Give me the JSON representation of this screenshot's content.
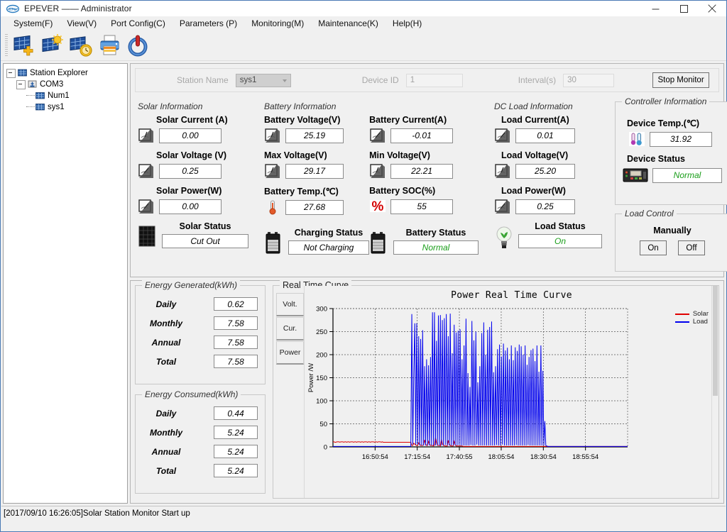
{
  "window": {
    "title": "EPEVER —— Administrator",
    "logo_icon": "epever-logo-icon",
    "minimize_icon": "minimize-icon",
    "maximize_icon": "maximize-icon",
    "close_icon": "close-icon"
  },
  "menubar": [
    {
      "label": "System(F)",
      "name": "menu-system"
    },
    {
      "label": "View(V)",
      "name": "menu-view"
    },
    {
      "label": "Port Config(C)",
      "name": "menu-port-config"
    },
    {
      "label": "Parameters (P)",
      "name": "menu-parameters"
    },
    {
      "label": "Monitoring(M)",
      "name": "menu-monitoring"
    },
    {
      "label": "Maintenance(K)",
      "name": "menu-maintenance"
    },
    {
      "label": "Help(H)",
      "name": "menu-help"
    }
  ],
  "toolbar": [
    {
      "icon": "add-station-icon"
    },
    {
      "icon": "solar-sun-icon"
    },
    {
      "icon": "solar-clock-icon"
    },
    {
      "icon": "print-icon"
    },
    {
      "icon": "power-icon"
    }
  ],
  "tree": {
    "root": {
      "label": "Station Explorer",
      "icon": "station-icon"
    },
    "com": {
      "label": "COM3",
      "icon": "port-icon"
    },
    "children": [
      {
        "label": "Num1",
        "icon": "device-icon"
      },
      {
        "label": "sys1",
        "icon": "device-icon"
      }
    ]
  },
  "header": {
    "station_name_label": "Station Name",
    "station_name_value": "sys1",
    "device_id_label": "Device ID",
    "device_id_value": "1",
    "interval_label": "Interval(s)",
    "interval_value": "30",
    "stop_monitor_label": "Stop Monitor"
  },
  "solar": {
    "legend": "Solar Information",
    "fields": [
      {
        "label": "Solar Current (A)",
        "value": "0.00",
        "icon": "ammeter-icon"
      },
      {
        "label": "Solar Voltage (V)",
        "value": "0.25",
        "icon": "voltmeter-icon"
      },
      {
        "label": "Solar Power(W)",
        "value": "0.00",
        "icon": "wattmeter-icon"
      }
    ],
    "status_label": "Solar Status",
    "status_value": "Cut Out",
    "status_icon": "solar-panel-icon"
  },
  "battery": {
    "legend": "Battery Information",
    "fields_left": [
      {
        "label": "Battery Voltage(V)",
        "value": "25.19",
        "icon": "voltmeter-icon"
      },
      {
        "label": "Max Voltage(V)",
        "value": "29.17",
        "icon": "voltmeter-icon"
      },
      {
        "label": "Battery Temp.(℃)",
        "value": "27.68",
        "icon": "thermometer-icon"
      }
    ],
    "fields_right": [
      {
        "label": "Battery Current(A)",
        "value": "-0.01",
        "icon": "ammeter-icon"
      },
      {
        "label": "Min Voltage(V)",
        "value": "22.21",
        "icon": "voltmeter-icon"
      },
      {
        "label": "Battery SOC(%)",
        "value": "55",
        "icon": "percent-icon"
      }
    ],
    "charging_status_label": "Charging Status",
    "charging_status_value": "Not Charging",
    "charging_status_icon": "battery-icon",
    "battery_status_label": "Battery Status",
    "battery_status_value": "Normal",
    "battery_status_icon": "battery-icon"
  },
  "load": {
    "legend": "DC Load Information",
    "fields": [
      {
        "label": "Load Current(A)",
        "value": "0.01",
        "icon": "ammeter-icon"
      },
      {
        "label": "Load Voltage(V)",
        "value": "25.20",
        "icon": "voltmeter-icon"
      },
      {
        "label": "Load Power(W)",
        "value": "0.25",
        "icon": "wattmeter-icon"
      }
    ],
    "status_label": "Load Status",
    "status_value": "On",
    "status_icon": "lightbulb-icon"
  },
  "controller": {
    "legend": "Controller Information",
    "temp_label": "Device Temp.(℃)",
    "temp_value": "31.92",
    "temp_icon": "thermometer-pair-icon",
    "status_label": "Device Status",
    "status_value": "Normal",
    "status_icon": "controller-icon"
  },
  "load_control": {
    "legend": "Load Control",
    "title": "Manually",
    "on_label": "On",
    "off_label": "Off"
  },
  "energy_generated": {
    "legend": "Energy Generated(kWh)",
    "rows": [
      {
        "label": "Daily",
        "value": "0.62"
      },
      {
        "label": "Monthly",
        "value": "7.58"
      },
      {
        "label": "Annual",
        "value": "7.58"
      },
      {
        "label": "Total",
        "value": "7.58"
      }
    ]
  },
  "energy_consumed": {
    "legend": "Energy Consumed(kWh)",
    "rows": [
      {
        "label": "Daily",
        "value": "0.44"
      },
      {
        "label": "Monthly",
        "value": "5.24"
      },
      {
        "label": "Annual",
        "value": "5.24"
      },
      {
        "label": "Total",
        "value": "5.24"
      }
    ]
  },
  "curve_panel": {
    "legend": "Real Time Curve",
    "tabs": [
      {
        "label": "Volt.",
        "name": "tab-volt"
      },
      {
        "label": "Cur.",
        "name": "tab-cur"
      },
      {
        "label": "Power",
        "name": "tab-power",
        "selected": true
      }
    ]
  },
  "colors": {
    "solar_series": "#e00000",
    "load_series": "#0000ee",
    "status_ok": "#1a9e1a",
    "accent": "#4a7ab5"
  },
  "statusbar": {
    "message": "[2017/09/10 16:26:05]Solar Station Monitor Start up"
  },
  "chart_data": {
    "type": "line",
    "title": "Power Real Time Curve",
    "xlabel": "",
    "ylabel": "Power /W",
    "ylim": [
      0,
      300
    ],
    "yticks": [
      0,
      50,
      100,
      150,
      200,
      250,
      300
    ],
    "grid": true,
    "legend_position": "right",
    "xticks": [
      "16:50:54",
      "17:15:54",
      "17:40:55",
      "18:05:54",
      "18:30:54",
      "18:55:54"
    ],
    "xtick_positions": [
      0.143,
      0.286,
      0.429,
      0.571,
      0.714,
      0.857
    ],
    "series": [
      {
        "name": "Solar",
        "color": "#e00000",
        "values": [
          11,
          11,
          10,
          10,
          11,
          11,
          11,
          10,
          11,
          11,
          11,
          10,
          11,
          11,
          10,
          11,
          11,
          10,
          11,
          11,
          11,
          10,
          11,
          11,
          10,
          11,
          11,
          11,
          10,
          11,
          11,
          10,
          11,
          11,
          11,
          10,
          11,
          11,
          10,
          11,
          11,
          11,
          10,
          11,
          11,
          10,
          11,
          11,
          11,
          10,
          11,
          10,
          10,
          10,
          10,
          10,
          10,
          10,
          10,
          10,
          10,
          10,
          10,
          10,
          10,
          10,
          10,
          10,
          10,
          10,
          10,
          10,
          10,
          10,
          10,
          10,
          10,
          10,
          10,
          10,
          3,
          3,
          8,
          6,
          4,
          3,
          3,
          9,
          6,
          3,
          3,
          3,
          4,
          15,
          7,
          3,
          3,
          12,
          6,
          3,
          3,
          3,
          2,
          4,
          20,
          10,
          3,
          3,
          3,
          2,
          16,
          7,
          3,
          3,
          2,
          2,
          2,
          14,
          6,
          3,
          2,
          2,
          2,
          12,
          5,
          2,
          2,
          2,
          2,
          2,
          2,
          2,
          1,
          1,
          1,
          1,
          1,
          1,
          1,
          1,
          1,
          1,
          1,
          1,
          1,
          1,
          1,
          1,
          1,
          1,
          1,
          1,
          1,
          1,
          1,
          1,
          1,
          1,
          1,
          1,
          1,
          1,
          1,
          1,
          1,
          1,
          1,
          1,
          1,
          1,
          1,
          1,
          1,
          1,
          1,
          1,
          1,
          1,
          1,
          1,
          1,
          1,
          1,
          1,
          1,
          1,
          1,
          1,
          1,
          1,
          1,
          1,
          1,
          1,
          1,
          1,
          1,
          1,
          1,
          1,
          1,
          1,
          1,
          1,
          1,
          1,
          1,
          1,
          1,
          1,
          1,
          1,
          1,
          1,
          1,
          1,
          1,
          1,
          1,
          1,
          1,
          1,
          1,
          1,
          1,
          1,
          1,
          1,
          1,
          1,
          1,
          1,
          1,
          1,
          1,
          1,
          1,
          1,
          1,
          1,
          1,
          1,
          1,
          1,
          1,
          1,
          1,
          1,
          1,
          1,
          1,
          1,
          1,
          1,
          1,
          1,
          1,
          1,
          1,
          1,
          1,
          1,
          1,
          1,
          1,
          1,
          1,
          1,
          1,
          1,
          1,
          1,
          1,
          1,
          1,
          1,
          1,
          1,
          1,
          1,
          1,
          1,
          1,
          1,
          1,
          1,
          1,
          1,
          1,
          1,
          1,
          1,
          1,
          1,
          1,
          1,
          1,
          1,
          1,
          1
        ]
      },
      {
        "name": "Load",
        "color": "#0000ee",
        "values": [
          1,
          1,
          1,
          1,
          1,
          1,
          1,
          1,
          1,
          1,
          1,
          1,
          1,
          1,
          1,
          1,
          1,
          1,
          1,
          1,
          1,
          1,
          1,
          1,
          1,
          1,
          1,
          1,
          1,
          1,
          1,
          1,
          1,
          1,
          1,
          1,
          1,
          1,
          1,
          1,
          1,
          1,
          1,
          1,
          1,
          1,
          1,
          1,
          1,
          1,
          1,
          1,
          1,
          1,
          1,
          1,
          1,
          1,
          1,
          1,
          1,
          1,
          1,
          1,
          1,
          1,
          1,
          1,
          1,
          1,
          1,
          1,
          1,
          1,
          1,
          1,
          1,
          1,
          1,
          1,
          288,
          5,
          160,
          268,
          5,
          268,
          5,
          240,
          3,
          234,
          3,
          253,
          3,
          175,
          3,
          190,
          3,
          177,
          3,
          195,
          3,
          292,
          3,
          292,
          3,
          230,
          3,
          285,
          3,
          286,
          3,
          275,
          3,
          279,
          4,
          288,
          3,
          240,
          3,
          289,
          3,
          203,
          3,
          265,
          3,
          248,
          3,
          252,
          4,
          255,
          3,
          190,
          3,
          220,
          3,
          278,
          3,
          160,
          3,
          130,
          4,
          273,
          3,
          231,
          3,
          250,
          5,
          140,
          3,
          175,
          3,
          247,
          3,
          270,
          3,
          200,
          3,
          254,
          3,
          260,
          3,
          272,
          3,
          162,
          3,
          175,
          4,
          212,
          3,
          222,
          3,
          196,
          5,
          224,
          3,
          209,
          3,
          215,
          3,
          190,
          3,
          220,
          3,
          188,
          3,
          216,
          4,
          208,
          3,
          222,
          3,
          218,
          3,
          200,
          3,
          220,
          3,
          178,
          4,
          195,
          3,
          210,
          3,
          213,
          3,
          186,
          3,
          220,
          3,
          163,
          3,
          220,
          3,
          165,
          3,
          56,
          3,
          2,
          1,
          1,
          1,
          1,
          1,
          1,
          1,
          1,
          1,
          1,
          1,
          1,
          1,
          1,
          1,
          1,
          1,
          1,
          1,
          1,
          1,
          1,
          1,
          1,
          1,
          1,
          1,
          1,
          1,
          1,
          1,
          1,
          1,
          1,
          1,
          1,
          1,
          1,
          1,
          1,
          1,
          1,
          1,
          1,
          1,
          1,
          1,
          1,
          1,
          1,
          1,
          1,
          1,
          1,
          1,
          1,
          1,
          1,
          1,
          1,
          1,
          1,
          1,
          1,
          1,
          1,
          1,
          1,
          1,
          1,
          1,
          1,
          1,
          1,
          1,
          1,
          1,
          1,
          1,
          1,
          1,
          1
        ]
      }
    ]
  }
}
